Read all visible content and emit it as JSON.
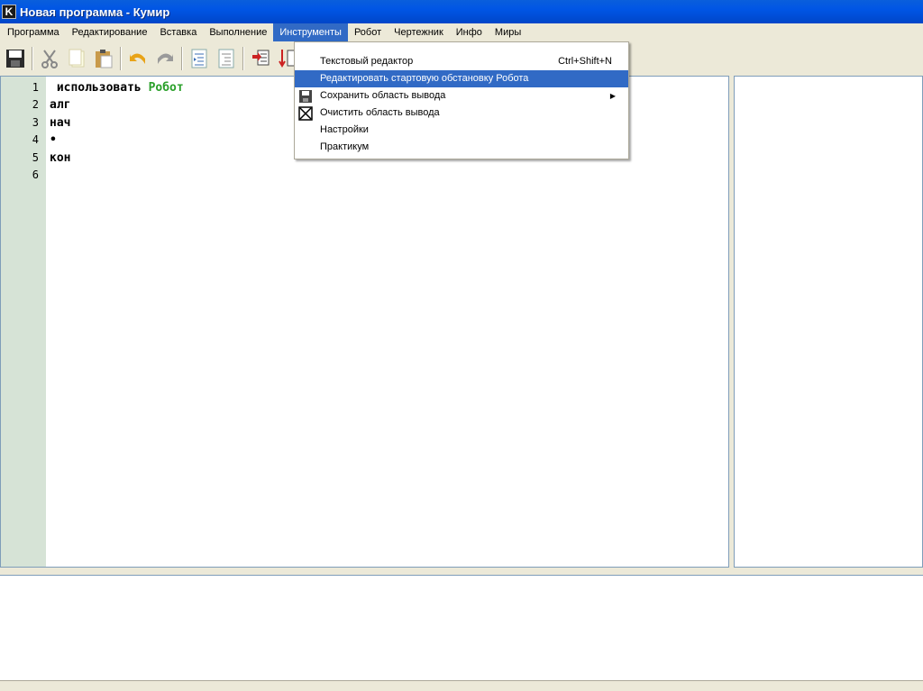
{
  "window": {
    "title": "Новая программа - Кумир",
    "icon_letter": "K"
  },
  "menubar": {
    "items": [
      {
        "label": "Программа"
      },
      {
        "label": "Редактирование"
      },
      {
        "label": "Вставка"
      },
      {
        "label": "Выполнение"
      },
      {
        "label": "Инструменты",
        "active": true
      },
      {
        "label": "Робот"
      },
      {
        "label": "Чертежник"
      },
      {
        "label": "Инфо"
      },
      {
        "label": "Миры"
      }
    ]
  },
  "toolbar": {
    "buttons": [
      "save-icon",
      "cut-icon",
      "copy-icon",
      "paste-icon",
      "undo-icon",
      "redo-icon",
      "indent-icon",
      "unindent-icon",
      "step-icon",
      "run-icon"
    ]
  },
  "editor": {
    "lines": [
      {
        "num": "1",
        "text_kw": " использовать ",
        "text_robot": "Робот"
      },
      {
        "num": "2",
        "text_kw": "алг",
        "text_robot": ""
      },
      {
        "num": "3",
        "text_kw": "нач",
        "text_robot": ""
      },
      {
        "num": "4",
        "text_kw": "•",
        "text_robot": ""
      },
      {
        "num": "5",
        "text_kw": "кон",
        "text_robot": ""
      },
      {
        "num": "6",
        "text_kw": "",
        "text_robot": ""
      }
    ]
  },
  "dropdown": {
    "items": [
      {
        "label": "Текстовый редактор",
        "shortcut": "Ctrl+Shift+N"
      },
      {
        "label": "Редактировать стартовую обстановку Робота",
        "highlighted": true
      },
      {
        "label": "Сохранить область вывода",
        "icon": "floppy-icon",
        "submenu": true
      },
      {
        "label": "Очистить область вывода",
        "icon": "clear-box-icon"
      },
      {
        "label": "Настройки"
      },
      {
        "label": "Практикум"
      }
    ]
  },
  "colors": {
    "title_bar": "#0055e5",
    "highlight": "#316ac5",
    "gutter": "#d6e3d6",
    "robot_keyword": "#2aa02a"
  }
}
